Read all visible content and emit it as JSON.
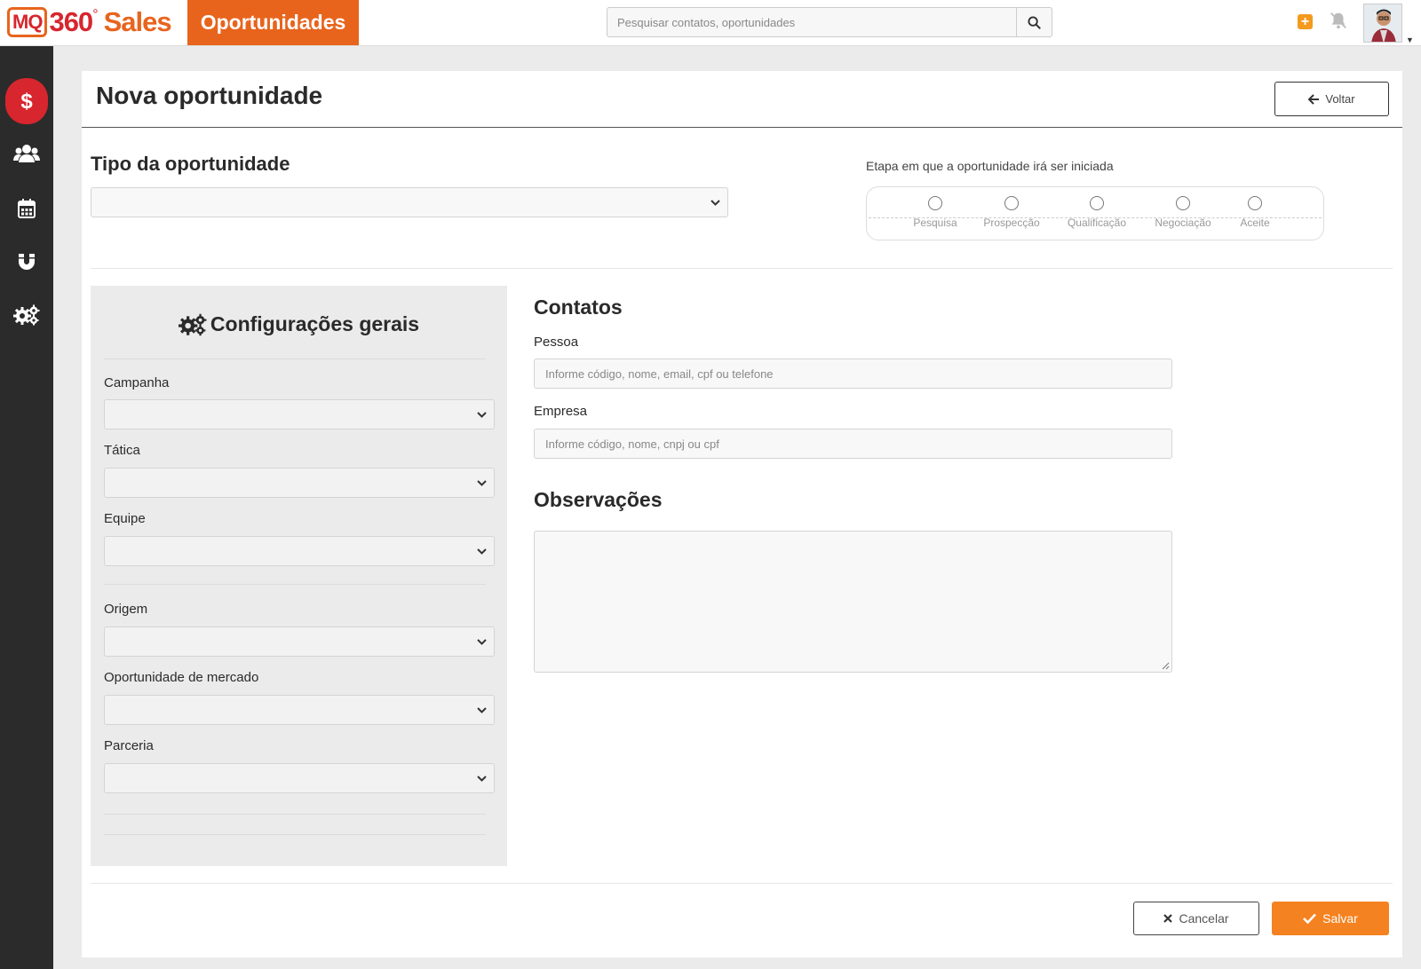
{
  "header": {
    "logo_mq": "MQ",
    "logo_360": "360",
    "logo_degree": "°",
    "logo_sales": "Sales",
    "module_tab": "Oportunidades",
    "search_placeholder": "Pesquisar contatos, oportunidades"
  },
  "sidebar": {
    "items": [
      {
        "icon": "dollar-icon",
        "active": true
      },
      {
        "icon": "users-icon",
        "active": false
      },
      {
        "icon": "calendar-icon",
        "active": false
      },
      {
        "icon": "magnet-icon",
        "active": false
      },
      {
        "icon": "gears-icon",
        "active": false
      }
    ]
  },
  "page": {
    "title": "Nova oportunidade",
    "back_label": "Voltar"
  },
  "tipo": {
    "label": "Tipo da oportunidade",
    "value": ""
  },
  "etapa": {
    "label": "Etapa em que a oportunidade irá ser iniciada",
    "stages": [
      "Pesquisa",
      "Prospecção",
      "Qualificação",
      "Negociação",
      "Aceite"
    ]
  },
  "config": {
    "title": "Configurações gerais",
    "fields": {
      "campanha": "Campanha",
      "tatica": "Tática",
      "equipe": "Equipe",
      "origem": "Origem",
      "oportunidade_mercado": "Oportunidade de mercado",
      "parceria": "Parceria"
    }
  },
  "contatos": {
    "title": "Contatos",
    "pessoa_label": "Pessoa",
    "pessoa_placeholder": "Informe código, nome, email, cpf ou telefone",
    "empresa_label": "Empresa",
    "empresa_placeholder": "Informe código, nome, cnpj ou cpf"
  },
  "observacoes": {
    "title": "Observações",
    "value": ""
  },
  "actions": {
    "cancel_label": "Cancelar",
    "save_label": "Salvar"
  },
  "colors": {
    "brand_orange": "#e8641d",
    "brand_red": "#d7262e",
    "save_orange": "#f58220",
    "sidebar_bg": "#2b2b2b"
  }
}
